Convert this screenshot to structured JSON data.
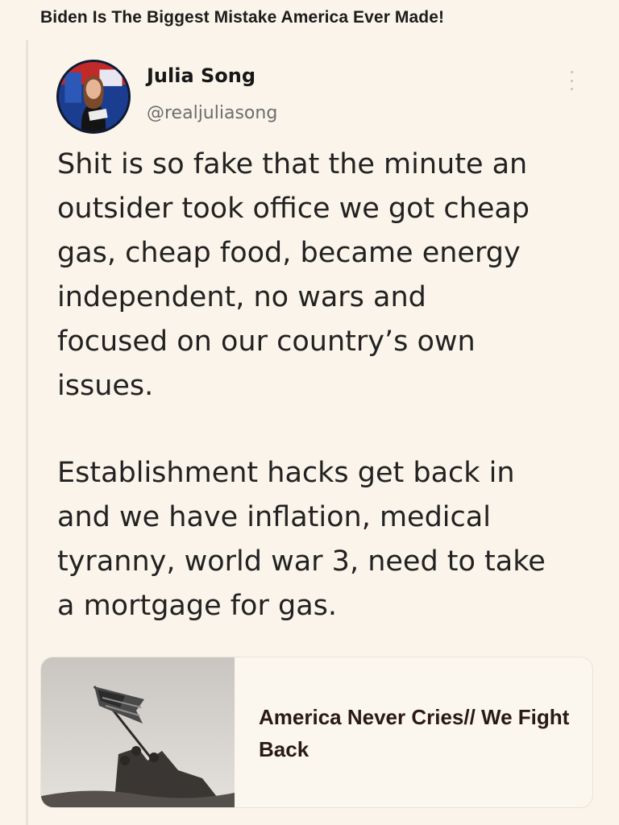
{
  "post": {
    "title": "Biden Is The Biggest Mistake America Ever Made!"
  },
  "tweet": {
    "author_name": "Julia Song",
    "author_handle": "@realjuliasong",
    "paragraph_1": "Shit is so fake that the minute an\noutsider took office we got cheap\ngas, cheap food, became energy\nindependent, no wars and\nfocused on our country’s own\nissues.",
    "paragraph_2": "Establishment hacks get back in\nand we have inflation, medical\ntyranny, world war 3, need to take\na mortgage for gas."
  },
  "link_card": {
    "title": "America Never Cries// We Fight Back"
  },
  "icons": {
    "more": "more-vertical-icon",
    "avatar": "avatar-photo",
    "thumbnail": "flag-raising-photo"
  },
  "colors": {
    "background": "#fbf4ea",
    "text": "#222222",
    "handle": "#6d6d6d",
    "card_title": "#2a1a14"
  }
}
